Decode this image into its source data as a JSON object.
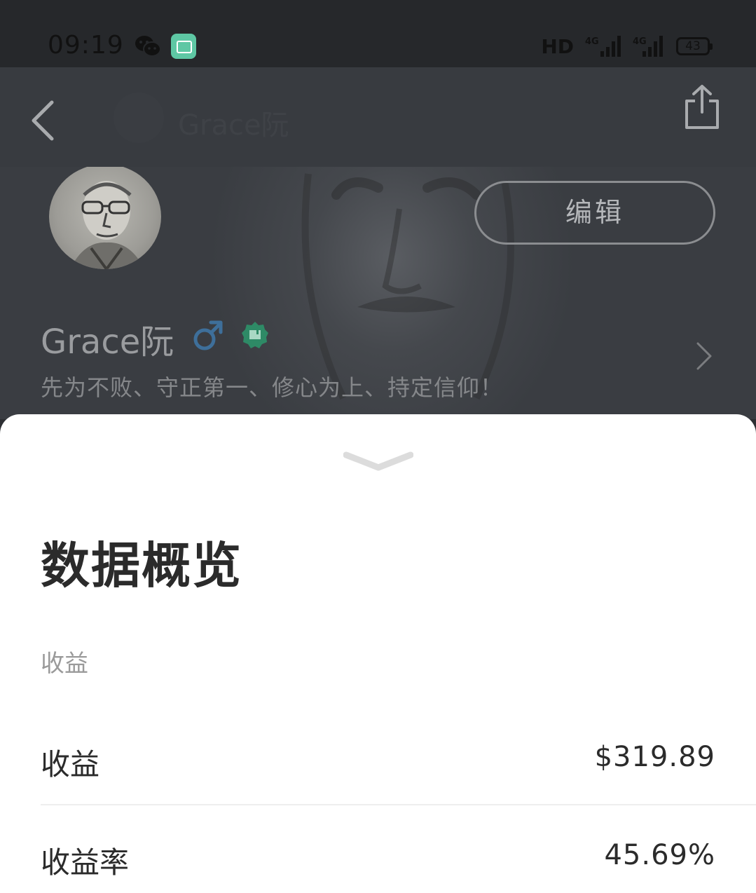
{
  "status_bar": {
    "time": "09:19",
    "network_label": "HD",
    "signal_1": "4G",
    "signal_2": "4G",
    "battery": "43"
  },
  "nav": {
    "title_name": "Grace阮"
  },
  "profile": {
    "name": "Grace阮",
    "gender_symbol": "♂",
    "bio": "先为不败、守正第一、修心为上、持定信仰！",
    "edit_label": "编辑"
  },
  "sheet": {
    "title": "数据概览",
    "section_label": "收益",
    "rows": [
      {
        "label": "收益",
        "value": "$319.89"
      },
      {
        "label": "收益率",
        "value": "45.69%"
      }
    ]
  },
  "colors": {
    "wechat": "#1a1a1a",
    "app_accent": "#5ec7a4",
    "gender_blue": "#3e6f9a",
    "badge_green": "#2e8a66"
  }
}
